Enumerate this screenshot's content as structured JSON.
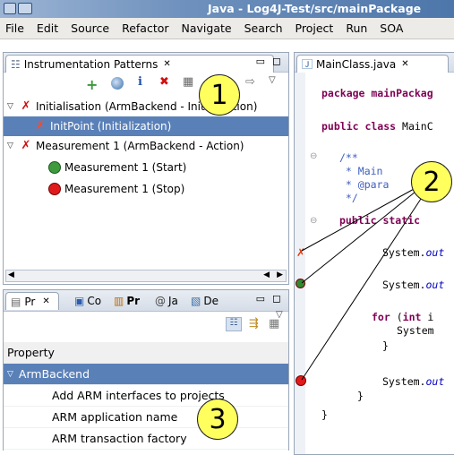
{
  "window": {
    "title": "Java - Log4J-Test/src/mainPackage"
  },
  "menu": [
    "File",
    "Edit",
    "Source",
    "Refactor",
    "Navigate",
    "Search",
    "Project",
    "Run",
    "SOA"
  ],
  "patterns_view": {
    "tab_label": "Instrumentation Patterns",
    "tab_close": "✕",
    "items": [
      {
        "label": "Initialisation (ArmBackend - Initialization)",
        "level": 0,
        "icon": "red-x",
        "expanded": true
      },
      {
        "label": "InitPoint (Initialization)",
        "level": 1,
        "icon": "red-x",
        "selected": true
      },
      {
        "label": "Measurement 1 (ArmBackend - Action)",
        "level": 0,
        "icon": "red-x",
        "expanded": true
      },
      {
        "label": "Measurement 1 (Start)",
        "level": 1,
        "icon": "green-circle"
      },
      {
        "label": "Measurement 1 (Stop)",
        "level": 1,
        "icon": "red-circle"
      }
    ]
  },
  "bottom_tabs": [
    {
      "label": "Pr",
      "close": "✕",
      "active": true
    },
    {
      "label": "Co"
    },
    {
      "label": "Pr",
      "bold": true
    },
    {
      "label": "Ja"
    },
    {
      "label": "De"
    }
  ],
  "properties": {
    "header": "Property",
    "group": "ArmBackend",
    "rows": [
      "Add ARM interfaces to projects",
      "ARM application name",
      "ARM transaction factory"
    ]
  },
  "editor": {
    "tab_label": "MainClass.java",
    "tab_close": "✕",
    "lines": {
      "l1": "package mainPackag",
      "l2_kw": "public class",
      "l2_rest": " MainC",
      "l3": "/**",
      "l4": " * Main",
      "l5": " * @para",
      "l6": " */",
      "l7_kw": "public static",
      "l8a": "System.",
      "l8b": "out",
      "l9a": "System.",
      "l9b": "out",
      "l10_kw": "for",
      "l10_rest": " (",
      "l10_kw2": "int",
      "l10_rest2": " i",
      "l11": "System",
      "l12": "}",
      "l13a": "System.",
      "l13b": "out",
      "l14": "}",
      "l15": "}"
    }
  },
  "callouts": [
    "1",
    "2",
    "3"
  ]
}
